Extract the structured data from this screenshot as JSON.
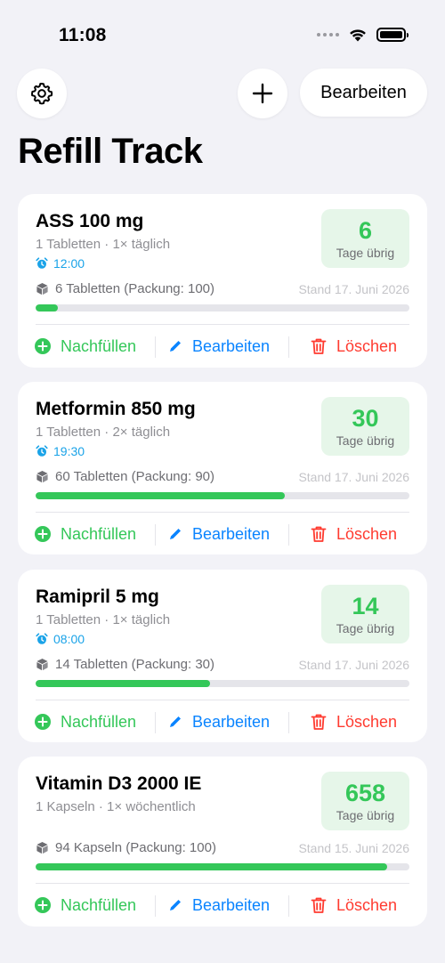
{
  "status": {
    "time": "11:08"
  },
  "header": {
    "edit_label": "Bearbeiten",
    "title": "Refill Track"
  },
  "colors": {
    "green": "#34c759",
    "blue": "#0a84ff",
    "red": "#ff3b30",
    "alarm": "#1aa3e8"
  },
  "actions": {
    "refill": "Nachfüllen",
    "edit": "Bearbeiten",
    "delete": "Löschen"
  },
  "medications": [
    {
      "name": "ASS 100 mg",
      "dose": "1 Tabletten · 1× täglich",
      "alarm": "12:00",
      "days": "6",
      "days_label": "Tage übrig",
      "stock": "6 Tabletten (Packung: 100)",
      "stand": "Stand 17. Juni 2026",
      "progress": 0.06
    },
    {
      "name": "Metformin 850 mg",
      "dose": "1 Tabletten · 2× täglich",
      "alarm": "19:30",
      "days": "30",
      "days_label": "Tage übrig",
      "stock": "60 Tabletten (Packung: 90)",
      "stand": "Stand 17. Juni 2026",
      "progress": 0.667
    },
    {
      "name": "Ramipril 5 mg",
      "dose": "1 Tabletten · 1× täglich",
      "alarm": "08:00",
      "days": "14",
      "days_label": "Tage übrig",
      "stock": "14 Tabletten (Packung: 30)",
      "stand": "Stand 17. Juni 2026",
      "progress": 0.467
    },
    {
      "name": "Vitamin D3 2000 IE",
      "dose": "1 Kapseln · 1× wöchentlich",
      "days": "658",
      "days_label": "Tage übrig",
      "stock": "94 Kapseln (Packung: 100)",
      "stand": "Stand 15. Juni 2026",
      "progress": 0.94
    }
  ]
}
